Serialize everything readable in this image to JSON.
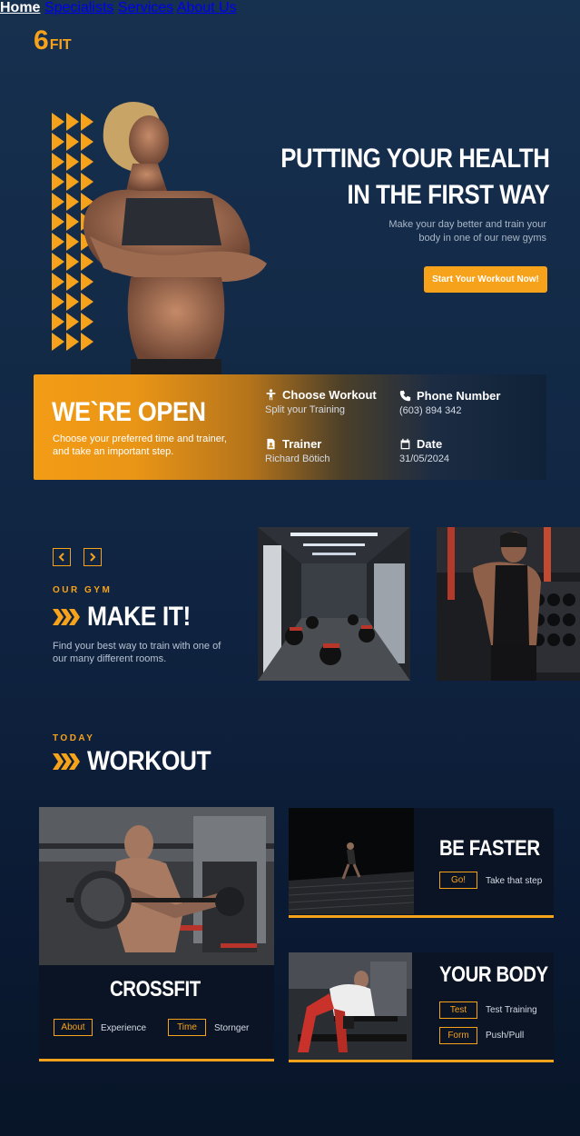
{
  "header": {
    "logo_num": "6",
    "logo_text": "FIT",
    "nav": [
      "Home",
      "Specialists",
      "Services",
      "About Us"
    ]
  },
  "hero": {
    "title_line1": "PUTTING YOUR HEALTH",
    "title_line2": "IN THE FIRST WAY",
    "subtitle": "Make your day better and train your body in one of our new gyms",
    "cta": "Start Your Workout Now!"
  },
  "open": {
    "title": "WE`RE OPEN",
    "desc": "Choose your preferred time and trainer, and take an important step.",
    "items": [
      {
        "label": "Choose Workout",
        "value": "Split your Training",
        "icon": "person-icon"
      },
      {
        "label": "Phone Number",
        "value": "(603) 894 342",
        "icon": "phone-icon"
      },
      {
        "label": "Trainer",
        "value": "Richard Bötich",
        "icon": "id-badge-icon"
      },
      {
        "label": "Date",
        "value": "31/05/2024",
        "icon": "calendar-icon"
      }
    ]
  },
  "gym": {
    "kicker": "OUR GYM",
    "title": "MAKE IT!",
    "desc": "Find your best way to train with one of our many different rooms."
  },
  "workout": {
    "kicker": "TODAY",
    "title": "WORKOUT",
    "crossfit": {
      "title": "CROSSFIT",
      "tags": [
        {
          "tag": "About",
          "text": "Experience"
        },
        {
          "tag": "Time",
          "text": "Stornger"
        }
      ]
    },
    "faster": {
      "title": "BE FASTER",
      "tags": [
        {
          "tag": "Go!",
          "text": "Take that step"
        }
      ]
    },
    "body": {
      "title": "YOUR BODY",
      "tags": [
        {
          "tag": "Test",
          "text": "Test Training"
        },
        {
          "tag": "Form",
          "text": "Push/Pull"
        }
      ]
    }
  },
  "colors": {
    "accent": "#f7a21b",
    "bg": "#132a47"
  }
}
